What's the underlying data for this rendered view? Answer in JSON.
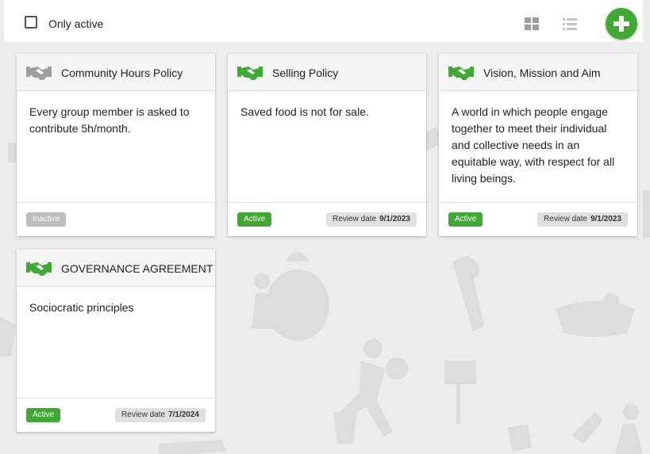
{
  "toolbar": {
    "only_active_label": "Only active",
    "only_active_checked": false,
    "grid_view_icon": "grid-view-icon",
    "list_view_icon": "list-view-icon",
    "add_icon": "plus-icon"
  },
  "colors": {
    "accent_green": "#3fa934",
    "inactive_gray": "#bdbdbd",
    "icon_gray": "#9e9e9e"
  },
  "cards": [
    {
      "title": "Community Hours Policy",
      "icon": "handshake-icon",
      "icon_color": "#9e9e9e",
      "body": "Every group member is asked to contribute 5h/month.",
      "status": "Inactive",
      "review_label": "",
      "review_date": ""
    },
    {
      "title": "Selling Policy",
      "icon": "handshake-icon",
      "icon_color": "#3fa934",
      "body": "Saved food is not for sale.",
      "status": "Active",
      "review_label": "Review date",
      "review_date": "9/1/2023"
    },
    {
      "title": "Vision, Mission and Aim",
      "icon": "handshake-icon",
      "icon_color": "#3fa934",
      "body": "A world in which people engage together to meet their individual and collective needs in an equitable way, with respect for all living beings.",
      "status": "Active",
      "review_label": "Review date",
      "review_date": "9/1/2023"
    },
    {
      "title": "GOVERNANCE AGREEMENT",
      "icon": "handshake-icon",
      "icon_color": "#3fa934",
      "body": "Sociocratic principles",
      "status": "Active",
      "review_label": "Review date",
      "review_date": "7/1/2024"
    }
  ]
}
